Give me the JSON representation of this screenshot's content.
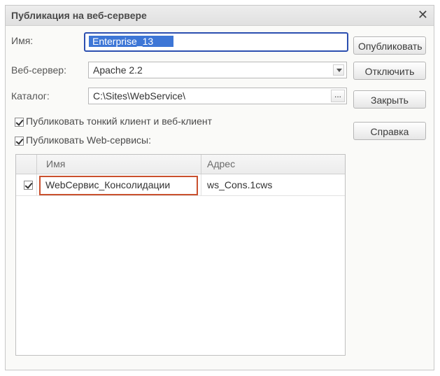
{
  "window": {
    "title": "Публикация на веб-сервере",
    "close_glyph": "✕"
  },
  "form": {
    "name_label": "Имя:",
    "name_value": "Enterprise_13",
    "webserver_label": "Веб-сервер:",
    "webserver_value": "Apache 2.2",
    "catalog_label": "Каталог:",
    "catalog_value": "C:\\Sites\\WebService\\",
    "catalog_browse": "...",
    "publish_thin_client_label": "Публиковать тонкий клиент и веб-клиент",
    "publish_thin_client_checked": true,
    "publish_web_services_label": "Публиковать Web-сервисы:",
    "publish_web_services_checked": true
  },
  "buttons": {
    "publish": "Опубликовать",
    "disable": "Отключить",
    "close": "Закрыть",
    "help": "Справка"
  },
  "table": {
    "columns": [
      "Имя",
      "Адрес"
    ],
    "rows": [
      {
        "checked": true,
        "name": "WebСервис_Консолидации",
        "address": "ws_Cons.1cws"
      }
    ]
  },
  "icons": {
    "close": "close-icon",
    "dropdown": "chevron-down-icon",
    "browse": "ellipsis-icon",
    "checkbox": "checkmark-icon"
  },
  "colors": {
    "selection": "#3d76d6",
    "focus_border": "#2c4fb0",
    "highlight_border": "#c9502e"
  }
}
